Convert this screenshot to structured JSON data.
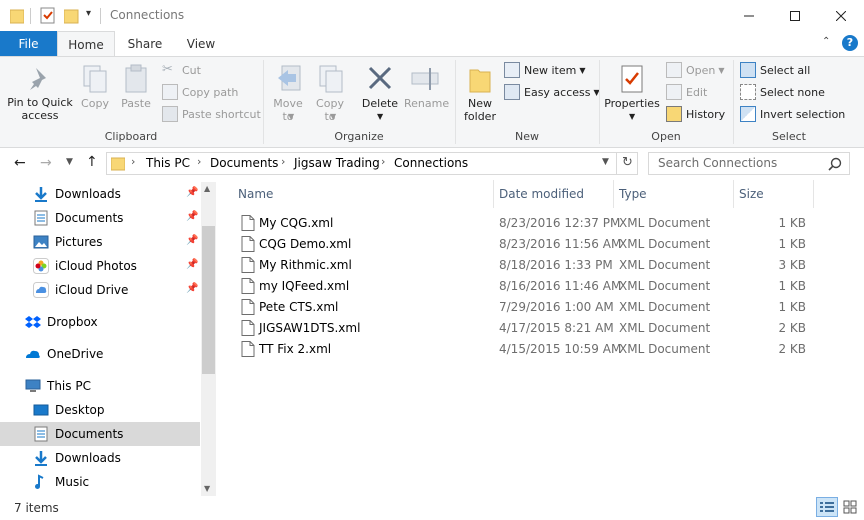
{
  "window": {
    "title": "Connections"
  },
  "ribbon": {
    "tabs": [
      "File",
      "Home",
      "Share",
      "View"
    ],
    "clipboard": {
      "pin_label": "Pin to Quick access",
      "copy_label": "Copy",
      "paste_label": "Paste",
      "cut_label": "Cut",
      "copy_path_label": "Copy path",
      "paste_shortcut_label": "Paste shortcut",
      "group_label": "Clipboard"
    },
    "organize": {
      "move_to_label": "Move to",
      "copy_to_label": "Copy to",
      "delete_label": "Delete",
      "rename_label": "Rename",
      "group_label": "Organize"
    },
    "new": {
      "new_folder_label": "New folder",
      "new_item_label": "New item",
      "easy_access_label": "Easy access",
      "group_label": "New"
    },
    "open": {
      "properties_label": "Properties",
      "open_label": "Open",
      "edit_label": "Edit",
      "history_label": "History",
      "group_label": "Open"
    },
    "select": {
      "select_all_label": "Select all",
      "select_none_label": "Select none",
      "invert_label": "Invert selection",
      "group_label": "Select"
    }
  },
  "address": {
    "crumbs": [
      "This PC",
      "Documents",
      "Jigsaw Trading",
      "Connections"
    ],
    "search_placeholder": "Search Connections"
  },
  "nav": {
    "items": [
      {
        "label": "Downloads",
        "icon": "download-icon",
        "pinned": true
      },
      {
        "label": "Documents",
        "icon": "document-icon",
        "pinned": true
      },
      {
        "label": "Pictures",
        "icon": "pictures-icon",
        "pinned": true
      },
      {
        "label": "iCloud Photos",
        "icon": "icloud-photos-icon",
        "pinned": true
      },
      {
        "label": "iCloud Drive",
        "icon": "icloud-drive-icon",
        "pinned": true
      },
      {
        "label": "Dropbox",
        "icon": "dropbox-icon",
        "pinned": false
      },
      {
        "label": "OneDrive",
        "icon": "onedrive-icon",
        "pinned": false
      },
      {
        "label": "This PC",
        "icon": "computer-icon",
        "pinned": false
      },
      {
        "label": "Desktop",
        "icon": "desktop-icon",
        "pinned": false
      },
      {
        "label": "Documents",
        "icon": "document-icon",
        "pinned": false,
        "selected": true
      },
      {
        "label": "Downloads",
        "icon": "download-icon",
        "pinned": false
      },
      {
        "label": "Music",
        "icon": "music-icon",
        "pinned": false
      }
    ]
  },
  "files": {
    "columns": [
      "Name",
      "Date modified",
      "Type",
      "Size"
    ],
    "rows": [
      {
        "name": "My CQG.xml",
        "date": "8/23/2016 12:37 PM",
        "type": "XML Document",
        "size": "1 KB"
      },
      {
        "name": "CQG Demo.xml",
        "date": "8/23/2016 11:56 AM",
        "type": "XML Document",
        "size": "1 KB"
      },
      {
        "name": "My Rithmic.xml",
        "date": "8/18/2016 1:33 PM",
        "type": "XML Document",
        "size": "3 KB"
      },
      {
        "name": "my IQFeed.xml",
        "date": "8/16/2016 11:46 AM",
        "type": "XML Document",
        "size": "1 KB"
      },
      {
        "name": "Pete CTS.xml",
        "date": "7/29/2016 1:00 AM",
        "type": "XML Document",
        "size": "1 KB"
      },
      {
        "name": "JIGSAW1DTS.xml",
        "date": "4/17/2015 8:21 AM",
        "type": "XML Document",
        "size": "2 KB"
      },
      {
        "name": "TT Fix 2.xml",
        "date": "4/15/2015 10:59 AM",
        "type": "XML Document",
        "size": "2 KB"
      }
    ]
  },
  "status": {
    "item_count": "7 items"
  },
  "colors": {
    "accent": "#1979ca",
    "folder": "#f8d775",
    "selection": "#d9d9d9"
  }
}
